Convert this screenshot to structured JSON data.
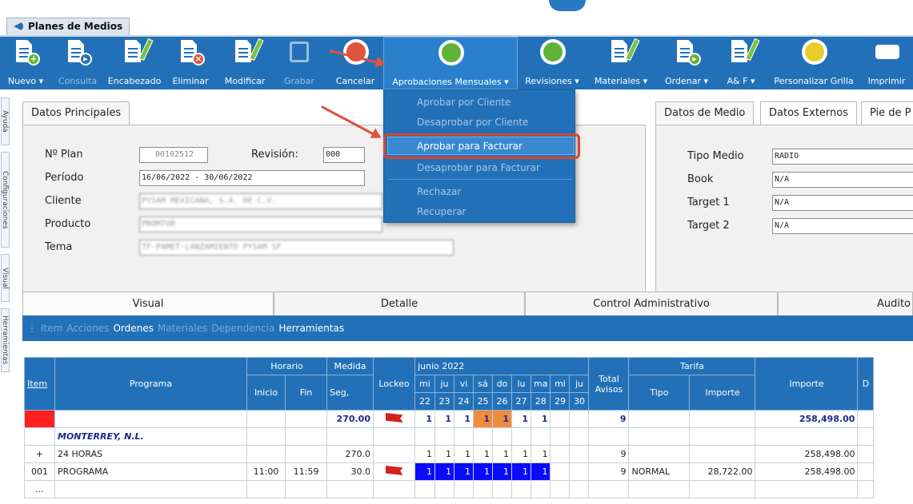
{
  "window": {
    "tab_label": "Planes de Medios"
  },
  "toolbar": {
    "buttons": [
      {
        "label": "Nuevo ▾",
        "enabled": true
      },
      {
        "label": "Consulta",
        "enabled": false
      },
      {
        "label": "Encabezado",
        "enabled": true
      },
      {
        "label": "Eliminar",
        "enabled": true
      },
      {
        "label": "Modificar",
        "enabled": true
      },
      {
        "label": "Grabar",
        "enabled": false
      },
      {
        "label": "Cancelar",
        "enabled": true
      },
      {
        "label": "Aprobaciones Mensuales ▾",
        "enabled": true
      },
      {
        "label": "Revisiones ▾",
        "enabled": true
      },
      {
        "label": "Materiales ▾",
        "enabled": true
      },
      {
        "label": "Ordenar ▾",
        "enabled": true
      },
      {
        "label": "A& F ▾",
        "enabled": true
      },
      {
        "label": "Personalizar Grilla",
        "enabled": true
      },
      {
        "label": "Imprimir",
        "enabled": true
      }
    ]
  },
  "dropdown": {
    "items": [
      {
        "label": "Aprobar por Cliente",
        "enabled": false
      },
      {
        "label": "Desaprobar por Cliente",
        "enabled": false
      },
      {
        "label": "Aprobar para Facturar",
        "enabled": true,
        "highlighted": true
      },
      {
        "label": "Desaprobar para Facturar",
        "enabled": false
      },
      {
        "label": "Rechazar",
        "enabled": false
      },
      {
        "label": "Recuperar",
        "enabled": false
      }
    ]
  },
  "side_tabs": [
    "Ayuda",
    "Configuraciones",
    "Visual",
    "Herramientas"
  ],
  "principal": {
    "tab": "Datos Principales",
    "plan_label": "Nº Plan",
    "plan_value": "00102512",
    "revision_label": "Revisión:",
    "revision_value": "000",
    "periodo_label": "Período",
    "periodo_value": "16/06/2022 - 30/06/2022",
    "cliente_label": "Cliente",
    "cliente_value": "PYSAM MEXICANA, S.A. DE C.V.",
    "producto_label": "Producto",
    "producto_value": "PROMTOR",
    "tema_label": "Tema",
    "tema_value": "TF-PAMET-LANZAMIENTO PYSAM SF"
  },
  "medio": {
    "tabs": [
      "Datos de Medio",
      "Datos Externos",
      "Pie de P"
    ],
    "tipo_medio_label": "Tipo Medio",
    "tipo_medio_value": "RADIO",
    "book_label": "Book",
    "book_value": "N/A",
    "target1_label": "Target 1",
    "target1_value": "N/A",
    "target2_label": "Target 2",
    "target2_value": "N/A"
  },
  "section_tabs": [
    "Visual",
    "Detalle",
    "Control Administrativo",
    "Audito"
  ],
  "subnav": [
    {
      "label": "Item",
      "active": false
    },
    {
      "label": "Acciones",
      "active": false
    },
    {
      "label": "Ordenes",
      "active": true
    },
    {
      "label": "Materiales",
      "active": false
    },
    {
      "label": "Dependencia",
      "active": false
    },
    {
      "label": "Herramientas",
      "active": true
    }
  ],
  "grid": {
    "headers": {
      "item": "Item",
      "programa": "Programa",
      "horario": "Horario",
      "inicio": "Inicio",
      "fin": "Fin",
      "medida": "Medida",
      "seg": "Seg,",
      "lockeo": "Lockeo",
      "month": "junio 2022",
      "total": "Total Avisos",
      "tarifa": "Tarifa",
      "tipo": "Tipo",
      "importe": "Importe",
      "importe2": "Importe",
      "extra": "D"
    },
    "days": [
      {
        "dow": "mi",
        "num": "22"
      },
      {
        "dow": "ju",
        "num": "23"
      },
      {
        "dow": "vi",
        "num": "24"
      },
      {
        "dow": "sá",
        "num": "25"
      },
      {
        "dow": "do",
        "num": "26"
      },
      {
        "dow": "lu",
        "num": "27"
      },
      {
        "dow": "ma",
        "num": "28"
      },
      {
        "dow": "mi",
        "num": "29"
      },
      {
        "dow": "ju",
        "num": "30"
      }
    ],
    "rows": [
      {
        "item": "",
        "programa": "",
        "inicio": "",
        "fin": "",
        "seg": "270.00",
        "lockeo": true,
        "days": [
          "1",
          "1",
          "1",
          "1",
          "1",
          "1",
          "1",
          "",
          ""
        ],
        "total": "9",
        "tipo": "",
        "importe": "",
        "importe2": "258,498.00",
        "style": "summary"
      },
      {
        "item": "",
        "programa": "MONTERREY, N.L.",
        "inicio": "",
        "fin": "",
        "seg": "",
        "lockeo": false,
        "days": [
          "",
          "",
          "",
          "",
          "",
          "",
          "",
          "",
          ""
        ],
        "total": "",
        "tipo": "",
        "importe": "",
        "importe2": "",
        "style": "region"
      },
      {
        "item": "+",
        "programa": "24 HORAS",
        "inicio": "",
        "fin": "",
        "seg": "270.0",
        "lockeo": false,
        "days": [
          "1",
          "1",
          "1",
          "1",
          "1",
          "1",
          "1",
          "",
          ""
        ],
        "total": "9",
        "tipo": "",
        "importe": "",
        "importe2": "258,498.00",
        "style": "group"
      },
      {
        "item": "001",
        "programa": "PROGRAMA",
        "inicio": "11:00",
        "fin": "11:59",
        "seg": "30.0",
        "lockeo": true,
        "days": [
          "1",
          "1",
          "1",
          "1",
          "1",
          "1",
          "1",
          "",
          ""
        ],
        "total": "9",
        "tipo": "NORMAL",
        "importe": "28,722.00",
        "importe2": "258,498.00",
        "style": "detail"
      },
      {
        "item": "...",
        "programa": "",
        "inicio": "",
        "fin": "",
        "seg": "",
        "lockeo": false,
        "days": [
          "",
          "",
          "",
          "",
          "",
          "",
          "",
          "",
          ""
        ],
        "total": "",
        "tipo": "",
        "importe": "",
        "importe2": "",
        "style": "more"
      }
    ]
  }
}
